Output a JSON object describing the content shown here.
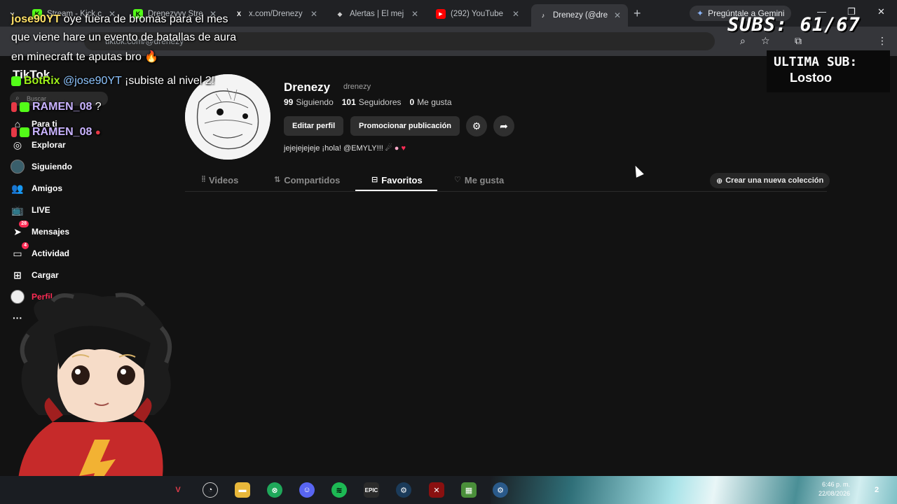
{
  "browser": {
    "tabs": [
      {
        "title": "Stream - Kick.c",
        "favicon": "K",
        "color": "#53fc18"
      },
      {
        "title": "Drenezyyy Stre",
        "favicon": "K",
        "color": "#53fc18"
      },
      {
        "title": "x.com/Drenezy",
        "favicon": "X",
        "color": "#ffffff"
      },
      {
        "title": "Alertas | El mej",
        "favicon": "◆",
        "color": "#cccccc"
      },
      {
        "title": "(292) YouTube",
        "favicon": "▶",
        "color": "#ff0000"
      },
      {
        "title": "Drenezy (@dre",
        "favicon": "♪",
        "color": "#ffffff"
      }
    ],
    "gemini_label": "Pregúntale a Gemini",
    "url": "tiktok.com/@drenezy"
  },
  "tiktok": {
    "logo": "TikTok",
    "search_placeholder": "Buscar",
    "nav": {
      "para_ti": "Para ti",
      "explorar": "Explorar",
      "siguiendo": "Siguiendo",
      "amigos": "Amigos",
      "live": "LIVE",
      "mensajes": "Mensajes",
      "mensajes_badge": "28",
      "actividad": "Actividad",
      "actividad_badge": "4",
      "cargar": "Cargar",
      "perfil": "Perfil",
      "more": "···"
    },
    "profile": {
      "name": "Drenezy",
      "handle": "drenezy",
      "following_count": "99",
      "following_label": "Siguiendo",
      "followers_count": "101",
      "followers_label": "Seguidores",
      "likes_count": "0",
      "likes_label": "Me gusta",
      "edit_button": "Editar perfil",
      "promote_button": "Promocionar publicación",
      "bio": "jejejejejeje ¡hola! @EMYLY!!!"
    },
    "tabs": {
      "videos": "Videos",
      "shared": "Compartidos",
      "favorites": "Favoritos",
      "liked": "Me gusta"
    },
    "new_collection": "Crear una nueva colección"
  },
  "overlay": {
    "chat": [
      {
        "user": "jose90YT",
        "text": " oye fuera de bromas para el mes"
      },
      {
        "text": "que viene hare un evento de batallas de aura"
      },
      {
        "text": "en minecraft te aputas bro 🔥"
      },
      {
        "user": "BotRix",
        "mention": "@jose90YT",
        "text": " ¡subiste al nivel 2!"
      },
      {
        "user": "RAMEN_08",
        "text": " ?"
      },
      {
        "user": "RAMEN_08",
        "text": ""
      }
    ],
    "subs_label": "SUBS: 61/67",
    "last_sub_title": "ULTIMA SUB:",
    "last_sub_name": "Lostoo"
  },
  "taskbar": {
    "time": "6:46 p. m.",
    "date": "22/08/2026",
    "notifications": "2"
  }
}
